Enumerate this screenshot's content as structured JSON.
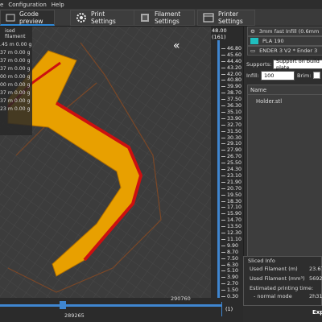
{
  "menubar": {
    "items": [
      "e",
      "Configuration",
      "Help"
    ]
  },
  "tabs": [
    {
      "label": "Gcode preview",
      "active": true
    },
    {
      "label": "Print Settings",
      "active": false
    },
    {
      "label": "Filament Settings",
      "active": false
    },
    {
      "label": "Printer Settings",
      "active": false
    }
  ],
  "legend": {
    "title": "ised filament",
    "rows": [
      ".45 m  0.00 g",
      "37 m  0.00 g",
      "37 m  0.00 g",
      "37 m  0.00 g",
      "00 m  0.00 g",
      "00 m  0.00 g",
      "37 m  0.00 g",
      "37 m  0.00 g",
      "23 m  0.00 g"
    ]
  },
  "vertical_slider": {
    "top_value": "48.00",
    "top_layer": "(161)",
    "bottom_layer": "(1)",
    "ticks": [
      "48.00",
      "46.80",
      "45.60",
      "44.40",
      "43.20",
      "42.00",
      "40.80",
      "39.90",
      "38.70",
      "37.50",
      "36.30",
      "35.10",
      "33.90",
      "32.70",
      "31.50",
      "30.30",
      "29.10",
      "27.90",
      "26.70",
      "25.50",
      "24.30",
      "23.10",
      "21.90",
      "20.70",
      "19.50",
      "18.30",
      "17.10",
      "15.90",
      "14.70",
      "13.50",
      "12.30",
      "11.10",
      "9.90",
      "8.70",
      "7.50",
      "6.30",
      "5.10",
      "3.90",
      "2.70",
      "1.50",
      "0.30"
    ]
  },
  "horizontal_slider": {
    "left_value": "289265",
    "right_value": "290760"
  },
  "right_panel": {
    "print_preset": "3mm fast Infill (0.6mm",
    "filament_preset": "PLA 190",
    "filament_color": "#1fbfbf",
    "printer_preset": "ENDER 3 V2 * Ender 3",
    "supports_label": "Supports:",
    "supports_value": "Support on build plate",
    "infill_label": "Infill:",
    "infill_value": "100",
    "brim_label": "Brim:",
    "list_header": "Name",
    "objects": [
      "Holder.stl"
    ]
  },
  "sliced_info": {
    "title": "Sliced Info",
    "rows": [
      {
        "label": "Used Filament (m)",
        "value": "23.67"
      },
      {
        "label": "Used Filament (mm³)",
        "value": "5692"
      },
      {
        "label": "Estimated printing time:",
        "value": ""
      },
      {
        "label": "- normal mode",
        "value": "2h31"
      }
    ],
    "export_label": "Exp"
  },
  "colors": {
    "accent": "#2f89d8",
    "print_orange": "#f0a000",
    "print_red": "#d01010"
  }
}
